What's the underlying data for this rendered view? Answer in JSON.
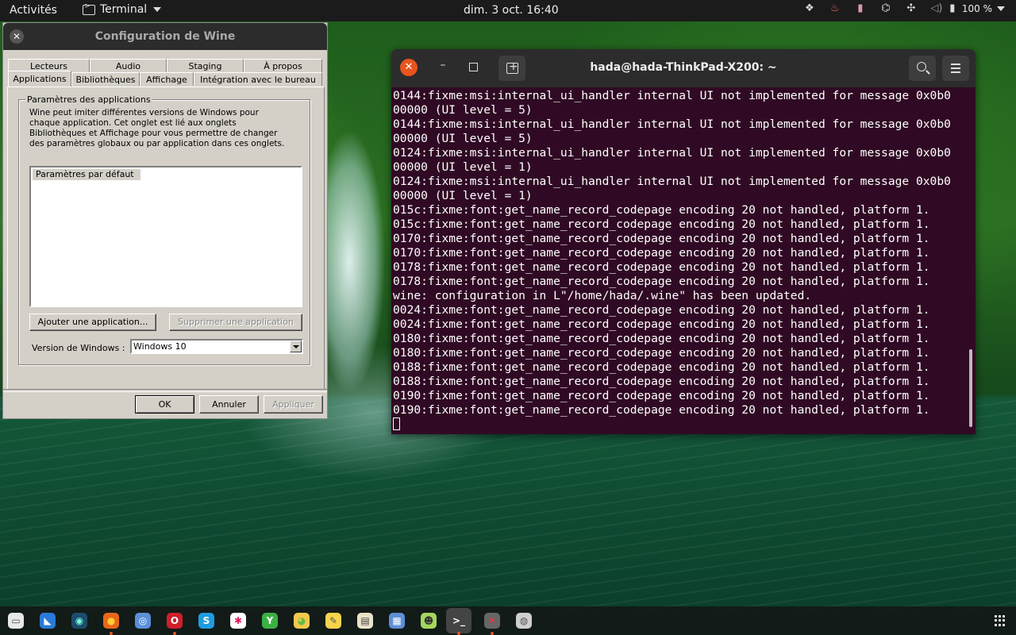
{
  "topbar": {
    "activities": "Activités",
    "app_name": "Terminal",
    "clock": "dim. 3 oct.  16:40",
    "battery": "100 %"
  },
  "wine": {
    "title": "Configuration de Wine",
    "tabs_back": [
      "Lecteurs",
      "Audio",
      "Staging",
      "À propos"
    ],
    "tabs_front": [
      "Applications",
      "Bibliothèques",
      "Affichage",
      "Intégration avec le bureau"
    ],
    "group_label": "Paramètres des applications",
    "description": "Wine peut imiter différentes versions de Windows pour chaque application. Cet onglet est lié aux onglets Bibliothèques et Affichage pour vous permettre de changer des paramètres globaux ou par application dans ces onglets.",
    "list_items": [
      "Paramètres par défaut"
    ],
    "add_button": "Ajouter une application...",
    "remove_button": "Supprimer une application",
    "version_label": "Version de Windows :",
    "version_value": "Windows 10",
    "ok_button": "OK",
    "cancel_button": "Annuler",
    "apply_button": "Appliquer"
  },
  "terminal": {
    "title": "hada@hada-ThinkPad-X200: ~",
    "lines": [
      "0144:fixme:msi:internal_ui_handler internal UI not implemented for message 0x0b0",
      "00000 (UI level = 5)",
      "0144:fixme:msi:internal_ui_handler internal UI not implemented for message 0x0b0",
      "00000 (UI level = 5)",
      "0124:fixme:msi:internal_ui_handler internal UI not implemented for message 0x0b0",
      "00000 (UI level = 1)",
      "0124:fixme:msi:internal_ui_handler internal UI not implemented for message 0x0b0",
      "00000 (UI level = 1)",
      "015c:fixme:font:get_name_record_codepage encoding 20 not handled, platform 1.",
      "015c:fixme:font:get_name_record_codepage encoding 20 not handled, platform 1.",
      "0170:fixme:font:get_name_record_codepage encoding 20 not handled, platform 1.",
      "0170:fixme:font:get_name_record_codepage encoding 20 not handled, platform 1.",
      "0178:fixme:font:get_name_record_codepage encoding 20 not handled, platform 1.",
      "0178:fixme:font:get_name_record_codepage encoding 20 not handled, platform 1.",
      "wine: configuration in L\"/home/hada/.wine\" has been updated.",
      "0024:fixme:font:get_name_record_codepage encoding 20 not handled, platform 1.",
      "0024:fixme:font:get_name_record_codepage encoding 20 not handled, platform 1.",
      "0180:fixme:font:get_name_record_codepage encoding 20 not handled, platform 1.",
      "0180:fixme:font:get_name_record_codepage encoding 20 not handled, platform 1.",
      "0188:fixme:font:get_name_record_codepage encoding 20 not handled, platform 1.",
      "0188:fixme:font:get_name_record_codepage encoding 20 not handled, platform 1.",
      "0190:fixme:font:get_name_record_codepage encoding 20 not handled, platform 1.",
      "0190:fixme:font:get_name_record_codepage encoding 20 not handled, platform 1."
    ]
  },
  "dock": {
    "items": [
      {
        "name": "files-icon",
        "glyph": "▭",
        "color": "#e8e8e8",
        "fg": "#555"
      },
      {
        "name": "vscode-icon",
        "glyph": "◣",
        "color": "#2a7ad8",
        "fg": "#fff"
      },
      {
        "name": "keepass-icon",
        "glyph": "◉",
        "color": "#1c4c6c",
        "fg": "#7fd"
      },
      {
        "name": "firefox-icon",
        "glyph": "●",
        "color": "#e8661b",
        "fg": "#ffcc33"
      },
      {
        "name": "chromium-icon",
        "glyph": "◎",
        "color": "#5b8fd8",
        "fg": "#fff"
      },
      {
        "name": "opera-icon",
        "glyph": "O",
        "color": "#d01f2a",
        "fg": "#fff"
      },
      {
        "name": "skype-icon",
        "glyph": "S",
        "color": "#1e9ce0",
        "fg": "#fff"
      },
      {
        "name": "slack-icon",
        "glyph": "✱",
        "color": "#ffffff",
        "fg": "#e01e5a"
      },
      {
        "name": "yandex-icon",
        "glyph": "Y",
        "color": "#3cb043",
        "fg": "#fff"
      },
      {
        "name": "lollypop-icon",
        "glyph": "◕",
        "color": "#f2c94c",
        "fg": "#6b4"
      },
      {
        "name": "notes-icon",
        "glyph": "✎",
        "color": "#f7d44c",
        "fg": "#555"
      },
      {
        "name": "calculator-icon",
        "glyph": "▤",
        "color": "#eae3c8",
        "fg": "#444"
      },
      {
        "name": "screenshot-icon",
        "glyph": "▦",
        "color": "#5d8fd6",
        "fg": "#fff"
      },
      {
        "name": "wine-app-icon",
        "glyph": "☻",
        "color": "#a3d65c",
        "fg": "#333"
      },
      {
        "name": "terminal-icon",
        "glyph": ">_",
        "color": "#2c2c2c",
        "fg": "#fff"
      },
      {
        "name": "bug-icon",
        "glyph": "✕",
        "color": "#666666",
        "fg": "#f33"
      },
      {
        "name": "disk-icon",
        "glyph": "◍",
        "color": "#cfcfcf",
        "fg": "#555"
      }
    ]
  }
}
